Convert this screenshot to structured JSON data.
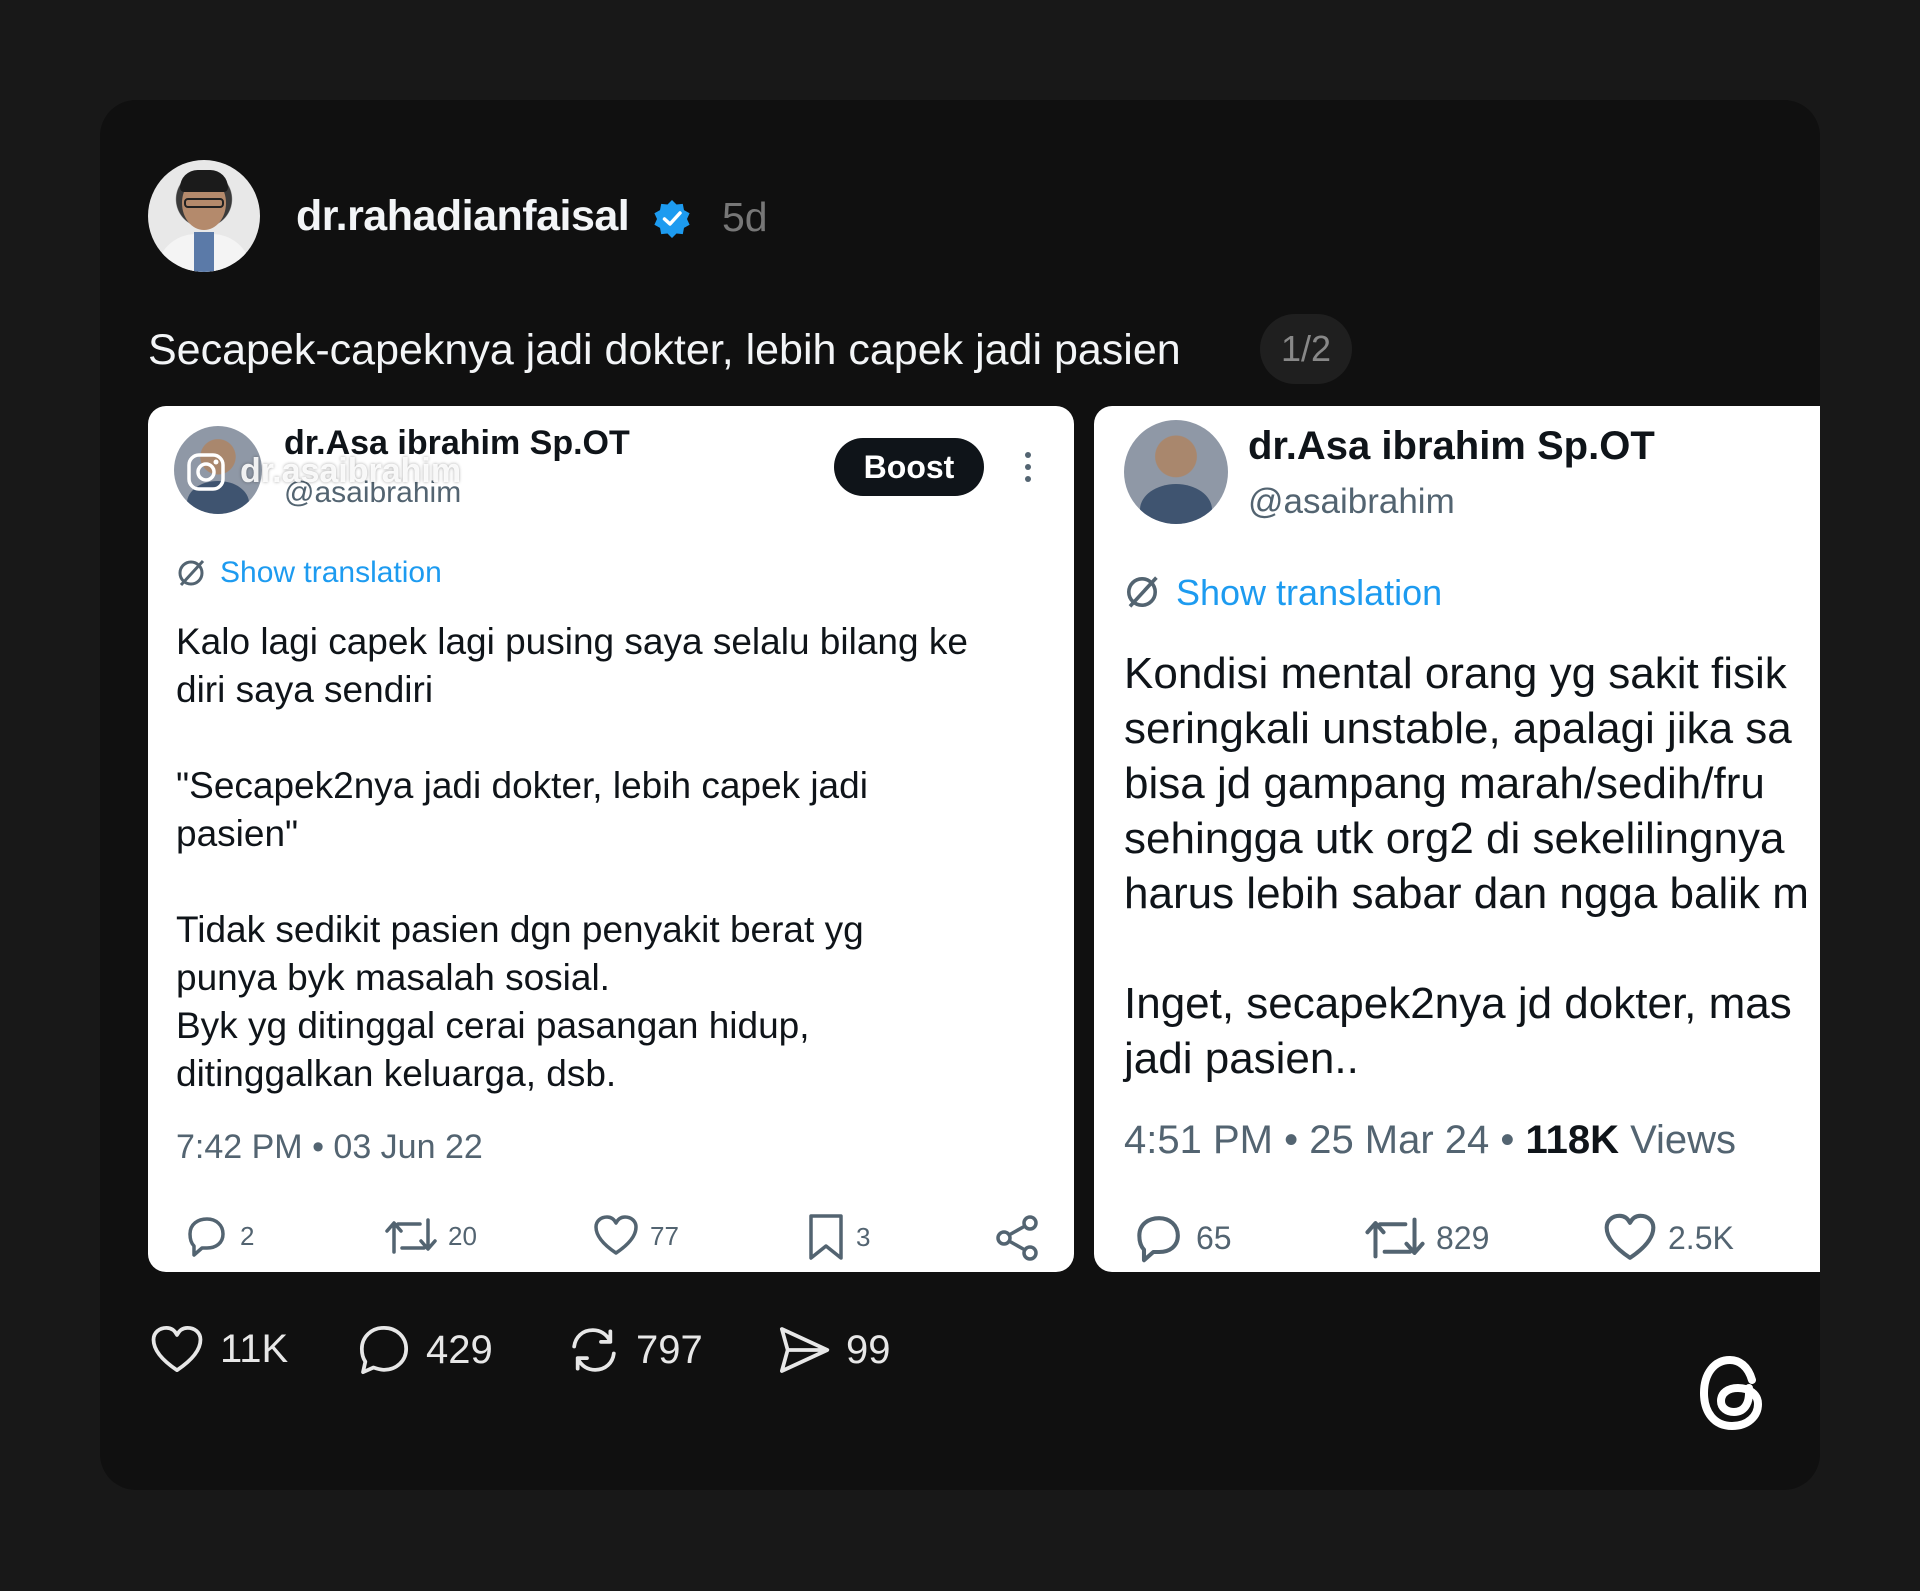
{
  "post": {
    "username": "dr.rahadianfaisal",
    "time_ago": "5d",
    "caption": "Secapek-capeknya jadi dokter, lebih capek jadi pasien",
    "pager": "1/2"
  },
  "tweets": [
    {
      "name": "dr.Asa ibrahim Sp.OT",
      "handle": "@asaibrahim",
      "watermark": "dr.asaibrahim",
      "boost_label": "Boost",
      "show_translation": "Show translation",
      "text": "Kalo lagi capek lagi pusing saya selalu bilang ke\ndiri saya sendiri\n\n\"Secapek2nya jadi dokter, lebih capek jadi\npasien\"\n\nTidak sedikit pasien dgn penyakit berat yg\npunya byk masalah sosial.\nByk yg ditinggal cerai pasangan hidup,\nditinggalkan keluarga, dsb.",
      "meta": "7:42 PM • 03 Jun 22",
      "replies": "2",
      "retweets": "20",
      "likes": "77",
      "bookmarks": "3"
    },
    {
      "name": "dr.Asa ibrahim Sp.OT",
      "handle": "@asaibrahim",
      "show_translation": "Show translation",
      "text": "Kondisi mental orang yg sakit fisik\nseringkali unstable, apalagi jika sa\nbisa jd gampang marah/sedih/fru\nsehingga utk org2 di sekelilingnya\nharus lebih sabar dan ngga balik m\n\nInget, secapek2nya jd dokter, mas\njadi pasien..",
      "meta_time": "4:51 PM • 25 Mar 24 • ",
      "meta_views_count": "118K",
      "meta_views_label": " Views",
      "replies": "65",
      "retweets": "829",
      "likes": "2.5K"
    }
  ],
  "actions": {
    "likes": "11K",
    "comments": "429",
    "reposts": "797",
    "shares": "99"
  },
  "colors": {
    "background": "#181818",
    "card": "#101010",
    "verified": "#1d9bf0",
    "link": "#1d9bf0"
  }
}
